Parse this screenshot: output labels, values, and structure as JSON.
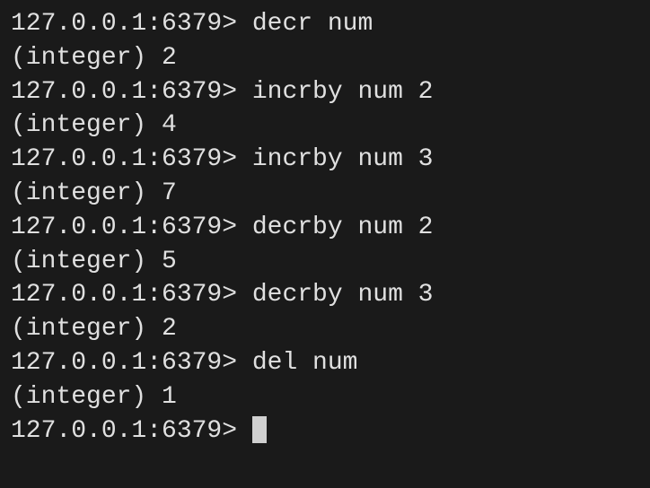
{
  "prompt": "127.0.0.1:6379> ",
  "lines": [
    {
      "type": "cmd",
      "command": "decr num"
    },
    {
      "type": "out",
      "text": "(integer) 2"
    },
    {
      "type": "cmd",
      "command": "incrby num 2"
    },
    {
      "type": "out",
      "text": "(integer) 4"
    },
    {
      "type": "cmd",
      "command": "incrby num 3"
    },
    {
      "type": "out",
      "text": "(integer) 7"
    },
    {
      "type": "cmd",
      "command": "decrby num 2"
    },
    {
      "type": "out",
      "text": "(integer) 5"
    },
    {
      "type": "cmd",
      "command": "decrby num 3"
    },
    {
      "type": "out",
      "text": "(integer) 2"
    },
    {
      "type": "cmd",
      "command": "del num"
    },
    {
      "type": "out",
      "text": "(integer) 1"
    }
  ],
  "current_command": ""
}
